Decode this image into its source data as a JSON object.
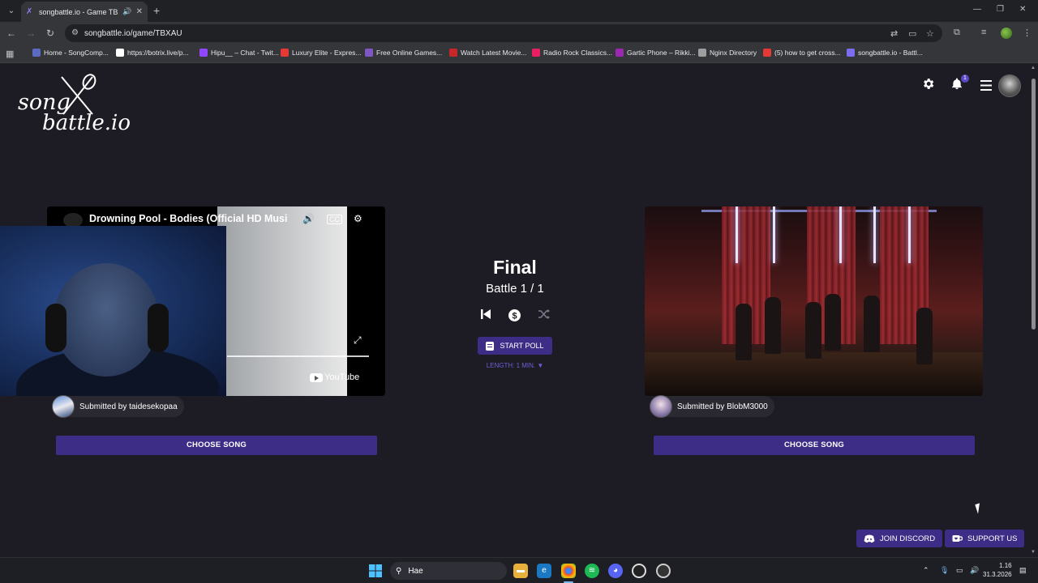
{
  "browser": {
    "tab_title": "songbattle.io - Game TBXAU",
    "url": "songbattle.io/game/TBXAU",
    "bookmarks": [
      {
        "label": "Home - SongComp...",
        "color": "#5c6bc0"
      },
      {
        "label": "https://botrix.live/p...",
        "color": "#fff"
      },
      {
        "label": "Hipu__ – Chat - Twit...",
        "color": "#9147ff"
      },
      {
        "label": "Luxury Elite - Expres...",
        "color": "#e53935"
      },
      {
        "label": "Free Online Games...",
        "color": "#7e57c2"
      },
      {
        "label": "Watch Latest Movie...",
        "color": "#c62828"
      },
      {
        "label": "Radio Rock Classics...",
        "color": "#e91e63"
      },
      {
        "label": "Gartic Phone – Rikki...",
        "color": "#9c27b0"
      },
      {
        "label": "Nginx Directory",
        "color": "#9e9e9e"
      },
      {
        "label": "(5) how to get cross...",
        "color": "#e53935"
      },
      {
        "label": "songbattle.io - Battl...",
        "color": "#7c6cf0"
      }
    ]
  },
  "site": {
    "logo_line1": "song",
    "logo_line2": "battle.io",
    "notification_count": "1"
  },
  "battle": {
    "title": "Final",
    "subtitle": "Battle 1 / 1",
    "start_poll": "START POLL",
    "length": "LENGTH: 1 MIN. ▼"
  },
  "left": {
    "video_title": "Drowning Pool - Bodies (Official HD Music Video)",
    "youtube": "YouTube",
    "submitted": "Submitted by taidesekopaa",
    "choose": "CHOOSE SONG"
  },
  "right": {
    "submitted": "Submitted by BlobM3000",
    "choose": "CHOOSE SONG"
  },
  "footer": {
    "discord": "JOIN DISCORD",
    "support": "SUPPORT US"
  },
  "taskbar": {
    "search": "Hae",
    "time": "1.16",
    "date": "31.3.2026"
  }
}
